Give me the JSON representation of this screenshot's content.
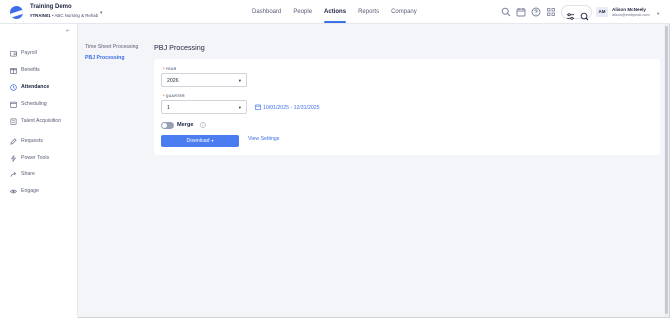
{
  "org": {
    "title": "Training Demo",
    "code": "#TRAIN01",
    "separator": " • ",
    "location": "ABC Nursing & Rehab"
  },
  "nav": [
    "Dashboard",
    "People",
    "Actions",
    "Reports",
    "Company"
  ],
  "nav_active": "Actions",
  "user": {
    "initials": "AM",
    "name": "Alison McNeely",
    "email": "alison@embpeak.com"
  },
  "sidebar": {
    "items": [
      {
        "label": "Payroll",
        "icon": "wallet-icon"
      },
      {
        "label": "Benefits",
        "icon": "gift-icon"
      },
      {
        "label": "Attendance",
        "icon": "clock-icon",
        "active": true
      },
      {
        "label": "Scheduling",
        "icon": "calendar-icon"
      },
      {
        "label": "Talent Acquisition",
        "icon": "clipboard-icon"
      },
      {
        "label": "Requests",
        "icon": "pencil-icon"
      },
      {
        "label": "Power Tools",
        "icon": "bolt-icon"
      },
      {
        "label": "Share",
        "icon": "share-icon"
      },
      {
        "label": "Engage",
        "icon": "eye-icon"
      }
    ]
  },
  "subnav": {
    "items": [
      "Time Sheet Processing",
      "PBJ Processing"
    ],
    "active": "PBJ Processing"
  },
  "page": {
    "title": "PBJ Processing",
    "year": {
      "label": "YEAR",
      "value": "2026"
    },
    "quarter": {
      "label": "QUARTER",
      "value": "1"
    },
    "date_range": "10/01/2025 - 12/31/2025",
    "merge_label": "Merge",
    "download_label": "Download",
    "view_settings_label": "View Settings"
  },
  "colors": {
    "accent": "#3b6fe8",
    "button": "#4b7df0",
    "required": "#e0413b"
  }
}
